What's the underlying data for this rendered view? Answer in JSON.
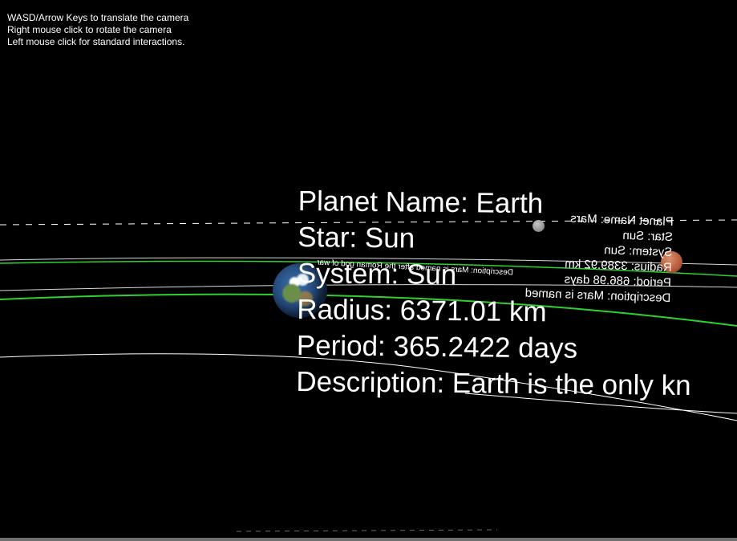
{
  "help": {
    "line1": "WASD/Arrow Keys to translate the camera",
    "line2": "Right mouse click to rotate the camera",
    "line3": "Left mouse click for standard interactions."
  },
  "earth": {
    "name": "Planet Name: Earth",
    "star": "Star: Sun",
    "system": "System: Sun",
    "radius": "Radius: 6371.01 km",
    "period": "Period: 365.2422 days",
    "description": "Description: Earth is the only kn"
  },
  "mars": {
    "name": "Planet Name: Mars",
    "star": "Star: Sun",
    "system": "System: Sun",
    "radius": "Radius: 3389.92 km",
    "period": "Period: 686.98 days",
    "description": "Description: Mars is named after the Roman god of war"
  },
  "colors": {
    "background": "#000000",
    "orbit_green": "#2fd12f",
    "orbit_white": "#ffffff"
  }
}
